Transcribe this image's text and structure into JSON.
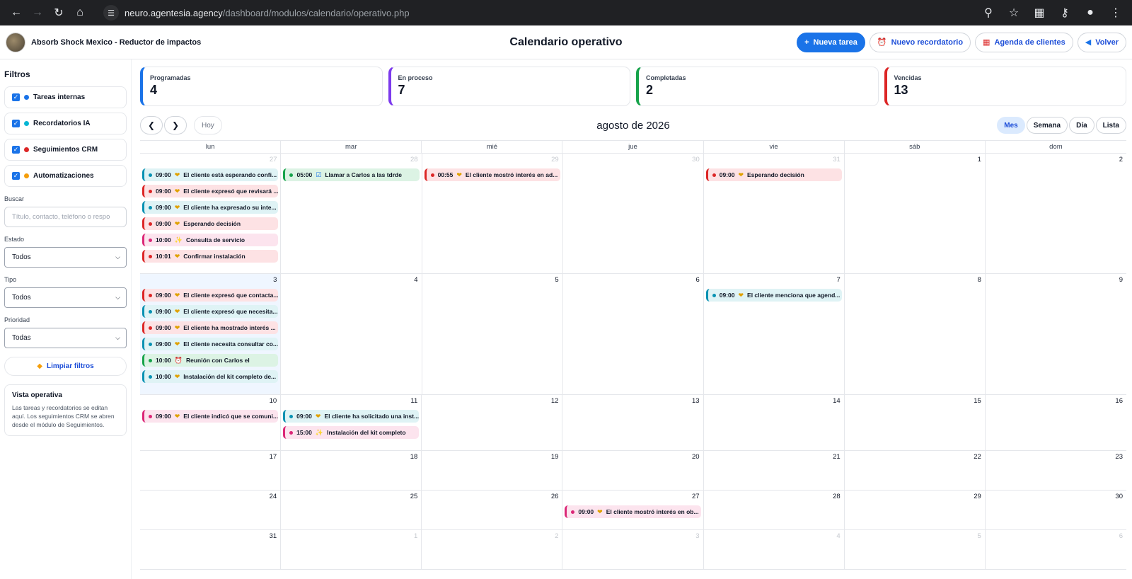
{
  "browser": {
    "url_host": "neuro.agentesia.agency",
    "url_path": "/dashboard/modulos/calendario/operativo.php"
  },
  "header": {
    "brand_name": "Absorb Shock Mexico - Reductor de impactos",
    "page_title": "Calendario operativo",
    "actions": [
      {
        "label": "Nueva tarea",
        "icon": "plus-icon"
      },
      {
        "label": "Nuevo recordatorio",
        "icon": "alarm-clock-icon"
      },
      {
        "label": "Agenda de clientes",
        "icon": "calendar-icon"
      },
      {
        "label": "Volver",
        "icon": "back-icon"
      }
    ]
  },
  "sidebar": {
    "title": "Filtros",
    "filters": [
      {
        "label": "Tareas internas",
        "color": "#1a73e8",
        "checked": true
      },
      {
        "label": "Recordatorios IA",
        "color": "#06b6d4",
        "checked": true
      },
      {
        "label": "Seguimientos CRM",
        "color": "#dc2626",
        "checked": true
      },
      {
        "label": "Automatizaciones",
        "color": "#f59e0b",
        "checked": true
      }
    ],
    "search_label": "Buscar",
    "search_placeholder": "Título, contacto, teléfono o respo",
    "estado_label": "Estado",
    "estado_value": "Todos",
    "tipo_label": "Tipo",
    "tipo_value": "Todos",
    "prioridad_label": "Prioridad",
    "prioridad_value": "Todas",
    "clear_label": "Limpiar filtros",
    "info_title": "Vista operativa",
    "info_text": "Las tareas y recordatorios se editan aquí. Los seguimientos CRM se abren desde el módulo de Seguimientos."
  },
  "stats": [
    {
      "label": "Programadas",
      "value": "4",
      "color": "#1a73e8"
    },
    {
      "label": "En proceso",
      "value": "7",
      "color": "#7c3aed"
    },
    {
      "label": "Completadas",
      "value": "2",
      "color": "#16a34a"
    },
    {
      "label": "Vencidas",
      "value": "13",
      "color": "#dc2626"
    }
  ],
  "calendar": {
    "today_label": "Hoy",
    "month_title": "agosto de 2026",
    "views": [
      {
        "label": "Mes",
        "active": true
      },
      {
        "label": "Semana",
        "active": false
      },
      {
        "label": "Día",
        "active": false
      },
      {
        "label": "Lista",
        "active": false
      }
    ],
    "weekdays": [
      "lun",
      "mar",
      "mié",
      "jue",
      "vie",
      "sáb",
      "dom"
    ],
    "weeks": [
      {
        "days": [
          {
            "num": "27",
            "muted": true,
            "events": [
              {
                "time": "09:00",
                "title": "El cliente está esperando confi...",
                "color": "teal",
                "icon": "heart-icon"
              },
              {
                "time": "09:00",
                "title": "El cliente expresó que revisará ...",
                "color": "red",
                "icon": "heart-icon"
              },
              {
                "time": "09:00",
                "title": "El cliente ha expresado su inte...",
                "color": "teal",
                "icon": "heart-icon"
              },
              {
                "time": "09:00",
                "title": "Esperando decisión",
                "color": "red",
                "icon": "heart-icon"
              },
              {
                "time": "10:00",
                "title": "Consulta de servicio",
                "color": "pink",
                "icon": "sparkle-icon"
              },
              {
                "time": "10:01",
                "title": "Confirmar instalación",
                "color": "red",
                "icon": "heart-icon"
              }
            ]
          },
          {
            "num": "28",
            "muted": true,
            "events": [
              {
                "time": "05:00",
                "title": "Llamar a Carlos a las tdrde",
                "color": "green",
                "icon": "checkbox-icon"
              }
            ]
          },
          {
            "num": "29",
            "muted": true,
            "events": [
              {
                "time": "00:55",
                "title": "El cliente mostró interés en ad...",
                "color": "red",
                "icon": "heart-icon"
              }
            ]
          },
          {
            "num": "30",
            "muted": true,
            "events": []
          },
          {
            "num": "31",
            "muted": true,
            "events": [
              {
                "time": "09:00",
                "title": "Esperando decisión",
                "color": "red",
                "icon": "heart-icon"
              }
            ]
          },
          {
            "num": "1",
            "muted": false,
            "events": []
          },
          {
            "num": "2",
            "muted": false,
            "events": []
          }
        ]
      },
      {
        "days": [
          {
            "num": "3",
            "muted": false,
            "today": true,
            "events": [
              {
                "time": "09:00",
                "title": "El cliente expresó que contacta...",
                "color": "red",
                "icon": "heart-icon"
              },
              {
                "time": "09:00",
                "title": "El cliente expresó que necesita...",
                "color": "teal",
                "icon": "heart-icon"
              },
              {
                "time": "09:00",
                "title": "El cliente ha mostrado interés ...",
                "color": "red",
                "icon": "heart-icon"
              },
              {
                "time": "09:00",
                "title": "El cliente necesita consultar co...",
                "color": "teal",
                "icon": "heart-icon"
              },
              {
                "time": "10:00",
                "title": "Reunión con Carlos el",
                "color": "green",
                "icon": "alarm-clock-icon"
              },
              {
                "time": "10:00",
                "title": "Instalación del kit completo de...",
                "color": "teal",
                "icon": "heart-icon"
              }
            ]
          },
          {
            "num": "4",
            "muted": false,
            "events": []
          },
          {
            "num": "5",
            "muted": false,
            "events": []
          },
          {
            "num": "6",
            "muted": false,
            "events": []
          },
          {
            "num": "7",
            "muted": false,
            "events": [
              {
                "time": "09:00",
                "title": "El cliente menciona que agend...",
                "color": "teal",
                "icon": "heart-icon"
              }
            ]
          },
          {
            "num": "8",
            "muted": false,
            "events": []
          },
          {
            "num": "9",
            "muted": false,
            "events": []
          }
        ]
      },
      {
        "days": [
          {
            "num": "10",
            "muted": false,
            "events": [
              {
                "time": "09:00",
                "title": "El cliente indicó que se comuni...",
                "color": "pink",
                "icon": "heart-icon"
              }
            ]
          },
          {
            "num": "11",
            "muted": false,
            "events": [
              {
                "time": "09:00",
                "title": "El cliente ha solicitado una inst...",
                "color": "teal",
                "icon": "heart-icon"
              },
              {
                "time": "15:00",
                "title": "Instalación del kit completo",
                "color": "pink",
                "icon": "sparkle-icon"
              }
            ]
          },
          {
            "num": "12",
            "muted": false,
            "events": []
          },
          {
            "num": "13",
            "muted": false,
            "events": []
          },
          {
            "num": "14",
            "muted": false,
            "events": []
          },
          {
            "num": "15",
            "muted": false,
            "events": []
          },
          {
            "num": "16",
            "muted": false,
            "events": []
          }
        ]
      },
      {
        "days": [
          {
            "num": "17",
            "muted": false,
            "events": []
          },
          {
            "num": "18",
            "muted": false,
            "events": []
          },
          {
            "num": "19",
            "muted": false,
            "events": []
          },
          {
            "num": "20",
            "muted": false,
            "events": []
          },
          {
            "num": "21",
            "muted": false,
            "events": []
          },
          {
            "num": "22",
            "muted": false,
            "events": []
          },
          {
            "num": "23",
            "muted": false,
            "events": []
          }
        ]
      },
      {
        "days": [
          {
            "num": "24",
            "muted": false,
            "events": []
          },
          {
            "num": "25",
            "muted": false,
            "events": []
          },
          {
            "num": "26",
            "muted": false,
            "events": []
          },
          {
            "num": "27",
            "muted": false,
            "events": [
              {
                "time": "09:00",
                "title": "El cliente mostró interés en ob...",
                "color": "pink",
                "icon": "heart-icon"
              }
            ]
          },
          {
            "num": "28",
            "muted": false,
            "events": []
          },
          {
            "num": "29",
            "muted": false,
            "events": []
          },
          {
            "num": "30",
            "muted": false,
            "events": []
          }
        ]
      },
      {
        "days": [
          {
            "num": "31",
            "muted": false,
            "events": []
          },
          {
            "num": "1",
            "muted": true,
            "events": []
          },
          {
            "num": "2",
            "muted": true,
            "events": []
          },
          {
            "num": "3",
            "muted": true,
            "events": []
          },
          {
            "num": "4",
            "muted": true,
            "events": []
          },
          {
            "num": "5",
            "muted": true,
            "events": []
          },
          {
            "num": "6",
            "muted": true,
            "events": []
          }
        ]
      }
    ]
  },
  "event_colors": {
    "red": "#dc2626",
    "teal": "#0891b2",
    "pink": "#db2777",
    "green": "#16a34a"
  }
}
